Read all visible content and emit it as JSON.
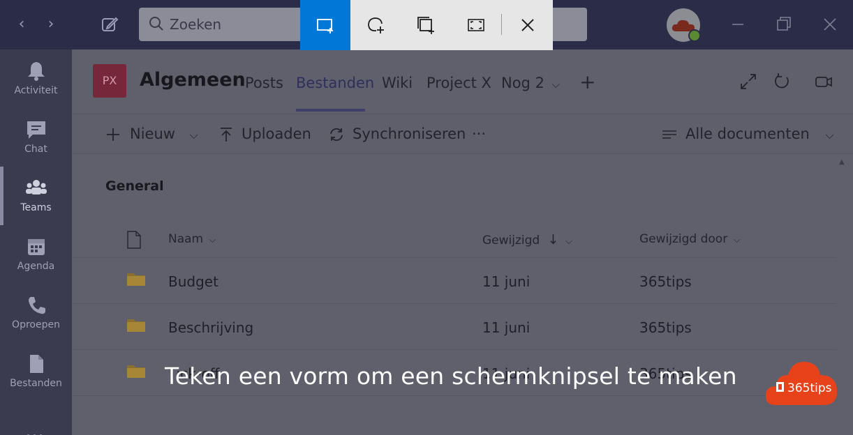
{
  "topbar": {
    "back_icon": "chevron-left-icon",
    "forward_icon": "chevron-right-icon",
    "search_placeholder": "Zoeken"
  },
  "snip_toolbar": {
    "modes": [
      {
        "name": "rectangular-snip",
        "icon": "rectangle-snip-icon",
        "active": true
      },
      {
        "name": "freeform-snip",
        "icon": "freeform-snip-icon",
        "active": false
      },
      {
        "name": "window-snip",
        "icon": "window-snip-icon",
        "active": false
      },
      {
        "name": "fullscreen-snip",
        "icon": "fullscreen-snip-icon",
        "active": false
      }
    ],
    "close_icon": "close-icon",
    "accent": "#0078d7"
  },
  "rail": {
    "items": [
      {
        "label": "Activiteit",
        "icon": "bell-icon"
      },
      {
        "label": "Chat",
        "icon": "chat-icon"
      },
      {
        "label": "Teams",
        "icon": "teams-icon",
        "active": true
      },
      {
        "label": "Agenda",
        "icon": "calendar-icon"
      },
      {
        "label": "Oproepen",
        "icon": "phone-icon"
      },
      {
        "label": "Bestanden",
        "icon": "file-icon"
      }
    ],
    "more": "..."
  },
  "channel": {
    "team_initials": "PX",
    "title": "Algemeen",
    "tabs": [
      {
        "label": "Posts"
      },
      {
        "label": "Bestanden",
        "active": true
      },
      {
        "label": "Wiki"
      },
      {
        "label": "Project X"
      },
      {
        "label": "Nog 2"
      }
    ],
    "add_tab": "+"
  },
  "commands": {
    "new": "Nieuw",
    "upload": "Uploaden",
    "sync": "Synchroniseren",
    "more": "···",
    "view": "Alle documenten"
  },
  "library": {
    "title": "General",
    "columns": {
      "name": "Naam",
      "modified": "Gewijzigd",
      "modified_by": "Gewijzigd door"
    },
    "rows": [
      {
        "name": "Budget",
        "modified": "11 juni",
        "modified_by": "365tips"
      },
      {
        "name": "Beschrijving",
        "modified": "11 juni",
        "modified_by": "365tips"
      },
      {
        "name": "Tick-off",
        "modified": "11 juni",
        "modified_by": "365tips"
      }
    ]
  },
  "overlay": {
    "caption": "Teken een vorm om een schermknipsel te maken"
  },
  "badge": {
    "text": "365tips",
    "color": "#e8421b"
  }
}
